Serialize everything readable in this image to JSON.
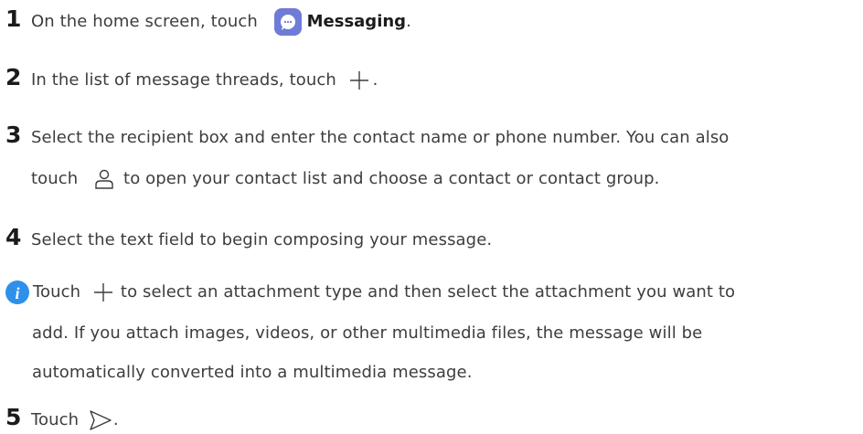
{
  "steps": [
    {
      "number": "1",
      "text_before": "On the home screen, touch",
      "app_name": "Messaging",
      "text_after": "."
    },
    {
      "number": "2",
      "text_before": "In the list of message threads, touch",
      "text_after": "."
    },
    {
      "number": "3",
      "line1": "Select the recipient box and enter the contact name or phone number. You can also",
      "line2_before": "touch",
      "line2_after": "to open your contact list and choose a contact or contact group."
    },
    {
      "number": "4",
      "text": "Select the text field to begin composing your message."
    },
    {
      "number": "5",
      "text_before": "Touch",
      "text_after": "."
    }
  ],
  "note": {
    "line1_before": "Touch",
    "line1_after": "to select an attachment type and then select the attachment you want to",
    "line2": "add. If you attach images, videos, or other multimedia files, the message will be",
    "line3": "automatically converted into a multimedia message."
  },
  "colors": {
    "accent": "#2e90ea",
    "messaging_icon": "#6f7bd6",
    "text": "#3d3d3d"
  }
}
